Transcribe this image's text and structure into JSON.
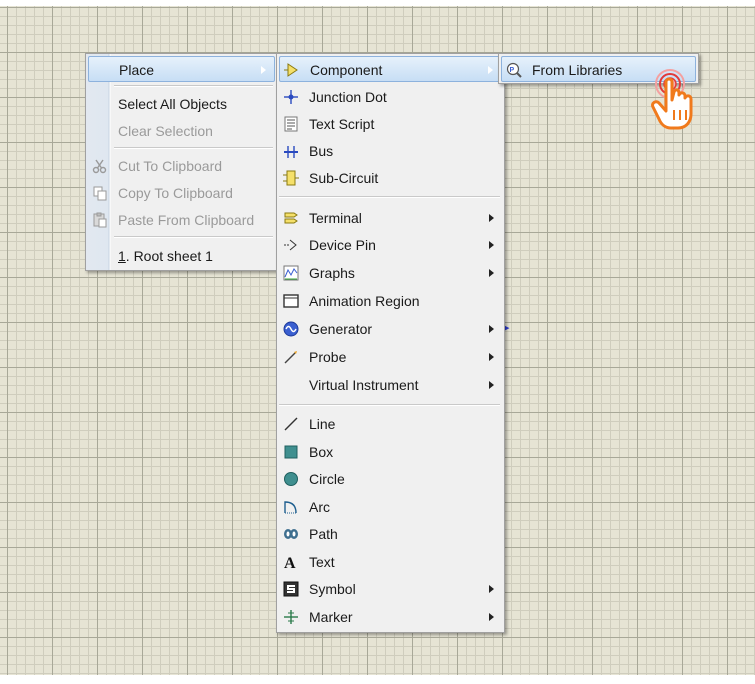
{
  "canvas": {
    "grid_color": "#a8a898",
    "background": "#e6e4d4"
  },
  "context_menu": {
    "items": [
      {
        "label": "Place",
        "highlighted": true,
        "submenu": true
      },
      {
        "label": "Select All Objects"
      },
      {
        "label": "Clear Selection",
        "disabled": true
      },
      {
        "label": "Cut To Clipboard",
        "disabled": true,
        "icon": "scissors-icon"
      },
      {
        "label": "Copy To Clipboard",
        "disabled": true,
        "icon": "copy-icon"
      },
      {
        "label": "Paste From Clipboard",
        "disabled": true,
        "icon": "paste-icon"
      },
      {
        "label_num": "1",
        "label_rest": ". Root sheet 1"
      }
    ]
  },
  "place_menu": {
    "items": [
      {
        "label": "Component",
        "icon": "component-icon",
        "highlighted": true,
        "submenu": true
      },
      {
        "label": "Junction Dot",
        "icon": "junction-dot-icon"
      },
      {
        "label": "Text Script",
        "icon": "text-script-icon"
      },
      {
        "label": "Bus",
        "icon": "bus-icon"
      },
      {
        "label": "Sub-Circuit",
        "icon": "sub-circuit-icon"
      },
      {
        "label": "Terminal",
        "icon": "terminal-icon",
        "submenu": true
      },
      {
        "label": "Device Pin",
        "icon": "device-pin-icon",
        "submenu": true
      },
      {
        "label": "Graphs",
        "icon": "graphs-icon",
        "submenu": true
      },
      {
        "label": "Animation Region",
        "icon": "animation-region-icon"
      },
      {
        "label": "Generator",
        "icon": "generator-icon",
        "submenu": true
      },
      {
        "label": "Probe",
        "icon": "probe-icon",
        "submenu": true
      },
      {
        "label": "Virtual Instrument",
        "submenu": true
      },
      {
        "label": "Line",
        "icon": "line-icon"
      },
      {
        "label": "Box",
        "icon": "box-icon"
      },
      {
        "label": "Circle",
        "icon": "circle-icon"
      },
      {
        "label": "Arc",
        "icon": "arc-icon"
      },
      {
        "label": "Path",
        "icon": "path-icon"
      },
      {
        "label": "Text",
        "icon": "text-icon"
      },
      {
        "label": "Symbol",
        "icon": "symbol-icon",
        "submenu": true
      },
      {
        "label": "Marker",
        "icon": "marker-icon",
        "submenu": true
      }
    ]
  },
  "component_menu": {
    "items": [
      {
        "label": "From Libraries",
        "icon": "library-search-icon",
        "highlighted": true
      }
    ]
  },
  "colors": {
    "highlight_border": "#8db2dd",
    "highlight_fill": "#c7def5",
    "cursor_orange": "#f07a1c",
    "click_ring": "#e23a3a"
  }
}
